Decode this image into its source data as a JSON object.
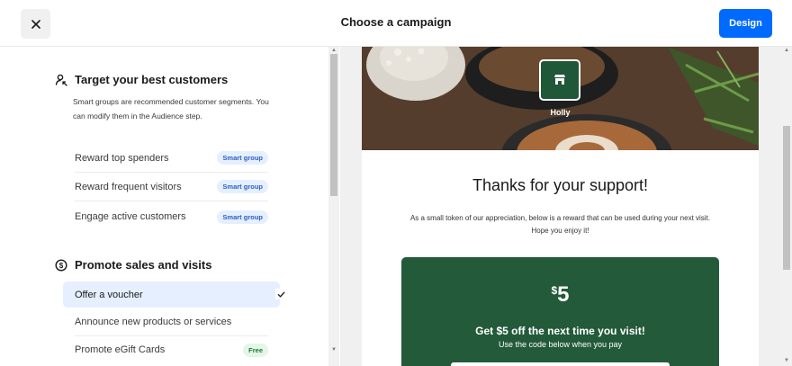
{
  "header": {
    "title": "Choose a campaign",
    "design_label": "Design",
    "close_icon": "close-icon"
  },
  "sections": {
    "target": {
      "title": "Target your best customers",
      "icon": "target-person-icon",
      "description": "Smart groups are recommended customer segments. You can modify them in the Audience step.",
      "items": [
        {
          "label": "Reward top spenders",
          "badge": "Smart group"
        },
        {
          "label": "Reward frequent visitors",
          "badge": "Smart group"
        },
        {
          "label": "Engage active customers",
          "badge": "Smart group"
        }
      ]
    },
    "promote": {
      "title": "Promote sales and visits",
      "icon": "dollar-circle-icon",
      "items": [
        {
          "label": "Offer a voucher",
          "selected": true
        },
        {
          "label": "Announce new products or services"
        },
        {
          "label": "Promote eGift Cards",
          "badge": "Free"
        }
      ]
    }
  },
  "preview": {
    "business_name": "Holly",
    "heading": "Thanks for your support!",
    "body": "As a small token of our appreciation, below is a reward that can be used during your next visit. Hope you enjoy it!",
    "voucher": {
      "currency": "$",
      "amount": "5",
      "offer": "Get $5 off the next time you visit!",
      "instructions": "Use the code below when you pay"
    }
  },
  "colors": {
    "accent": "#006aff",
    "voucher_bg": "#235a3a",
    "selected_bg": "#e6efff"
  }
}
